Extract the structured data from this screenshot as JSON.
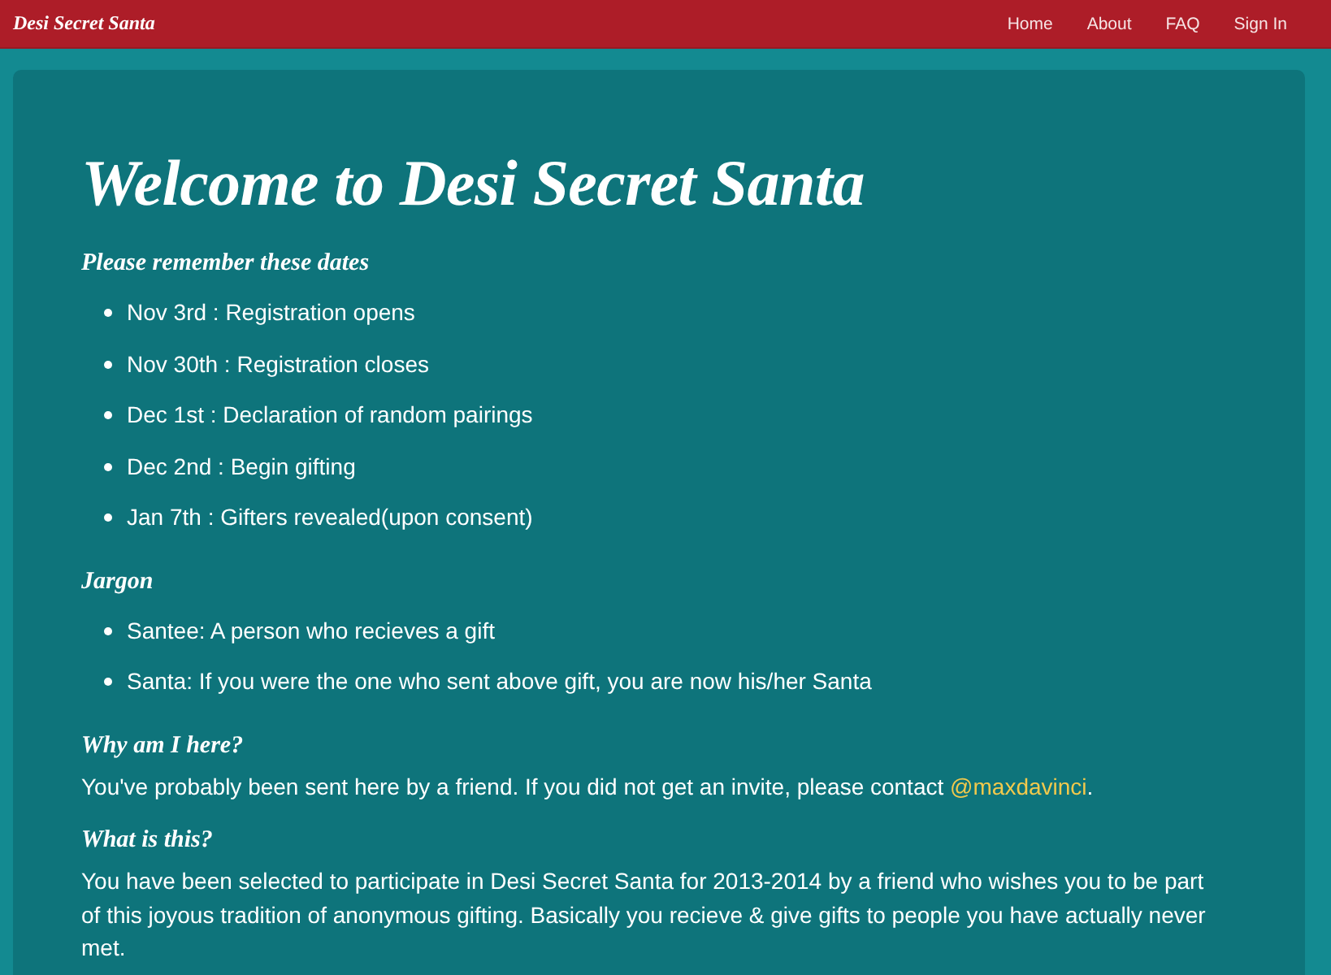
{
  "navbar": {
    "brand": "Desi Secret Santa",
    "links": [
      {
        "label": "Home"
      },
      {
        "label": "About"
      },
      {
        "label": "FAQ"
      },
      {
        "label": "Sign In"
      }
    ]
  },
  "panel": {
    "title": "Welcome to Desi Secret Santa",
    "sections": [
      {
        "kind": "list",
        "heading": "Please remember these dates",
        "items": [
          "Nov 3rd : Registration opens",
          "Nov 30th : Registration closes",
          "Dec 1st : Declaration of random pairings",
          "Dec 2nd : Begin gifting",
          "Jan 7th : Gifters revealed(upon consent)"
        ]
      },
      {
        "kind": "list",
        "heading": "Jargon",
        "items": [
          "Santee: A person who recieves a gift",
          "Santa: If you were the one who sent above gift, you are now his/her Santa"
        ]
      },
      {
        "kind": "paragraph",
        "heading": "Why am I here?",
        "text": "You've probably been sent here by a friend. If you did not get an invite, please contact",
        "link": "@maxdavinci",
        "text_after": "."
      },
      {
        "kind": "paragraph",
        "heading": "What is this?",
        "text": "You have been selected to participate in Desi Secret Santa for 2013-2014 by a friend who wishes you to be part of this joyous tradition of anonymous gifting. Basically you recieve & give gifts to people you have actually never met."
      }
    ]
  }
}
